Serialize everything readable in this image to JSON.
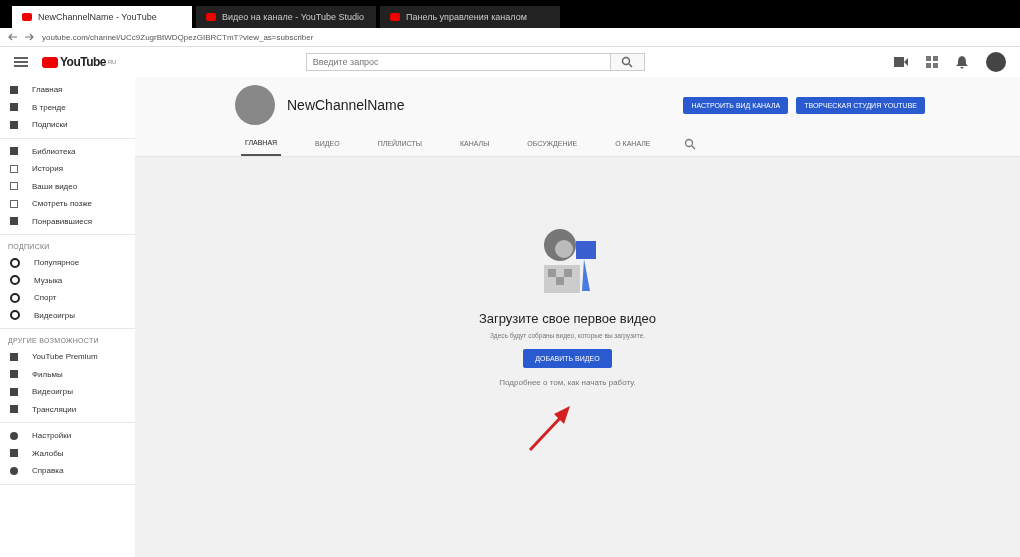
{
  "browser": {
    "tabs": [
      {
        "title": "NewChannelName - YouTube",
        "selected": true
      },
      {
        "title": "Видео на канале - YouTube Studio",
        "selected": false
      },
      {
        "title": "Панель управления каналом",
        "selected": false
      }
    ],
    "url": "youtube.com/channel/UCc9ZugrBtWDQpezGIBRCTmT?view_as=subscriber"
  },
  "header": {
    "logo": "YouTube",
    "logo_suffix": "RU",
    "search": {
      "placeholder": "Введите запрос"
    }
  },
  "sidebar": {
    "sections": [
      {
        "items": [
          {
            "label": "Главная",
            "selected": false
          },
          {
            "label": "В тренде",
            "selected": false
          },
          {
            "label": "Подписки",
            "selected": false
          }
        ]
      },
      {
        "items": [
          {
            "label": "Библиотека",
            "selected": false
          },
          {
            "label": "История",
            "selected": false
          },
          {
            "label": "Ваши видео",
            "selected": false
          },
          {
            "label": "Смотреть позже",
            "selected": false
          },
          {
            "label": "Понравившиеся",
            "selected": false
          }
        ]
      },
      {
        "title": "ПОДПИСКИ",
        "items": [
          {
            "label": "Популярное",
            "selected": false
          },
          {
            "label": "Музыка",
            "selected": false
          },
          {
            "label": "Спорт",
            "selected": false
          },
          {
            "label": "Видеоигры",
            "selected": false
          }
        ]
      },
      {
        "title": "ДРУГИЕ ВОЗМОЖНОСТИ",
        "items": [
          {
            "label": "YouTube Premium",
            "selected": false
          },
          {
            "label": "Фильмы",
            "selected": false
          },
          {
            "label": "Видеоигры",
            "selected": false
          },
          {
            "label": "Трансляции",
            "selected": false
          }
        ]
      },
      {
        "items": [
          {
            "label": "Настройки",
            "selected": false
          },
          {
            "label": "Жалобы",
            "selected": false
          },
          {
            "label": "Справка",
            "selected": false
          }
        ]
      }
    ]
  },
  "channel": {
    "name": "NewChannelName",
    "buttons": [
      "НАСТРОИТЬ ВИД КАНАЛА",
      "ТВОРЧЕСКАЯ СТУДИЯ YOUTUBE"
    ],
    "tabs": [
      {
        "label": "ГЛАВНАЯ",
        "selected": true
      },
      {
        "label": "ВИДЕО",
        "selected": false
      },
      {
        "label": "ПЛЕЙЛИСТЫ",
        "selected": false
      },
      {
        "label": "КАНАЛЫ",
        "selected": false
      },
      {
        "label": "ОБСУЖДЕНИЕ",
        "selected": false
      },
      {
        "label": "О КАНАЛЕ",
        "selected": false
      }
    ]
  },
  "empty_state": {
    "title": "Загрузите свое первое видео",
    "subtitle": "Здесь будут собраны видео, которые вы загрузите.",
    "button": "ДОБАВИТЬ ВИДЕО",
    "help": "Подробнее о том, как начать работу."
  }
}
